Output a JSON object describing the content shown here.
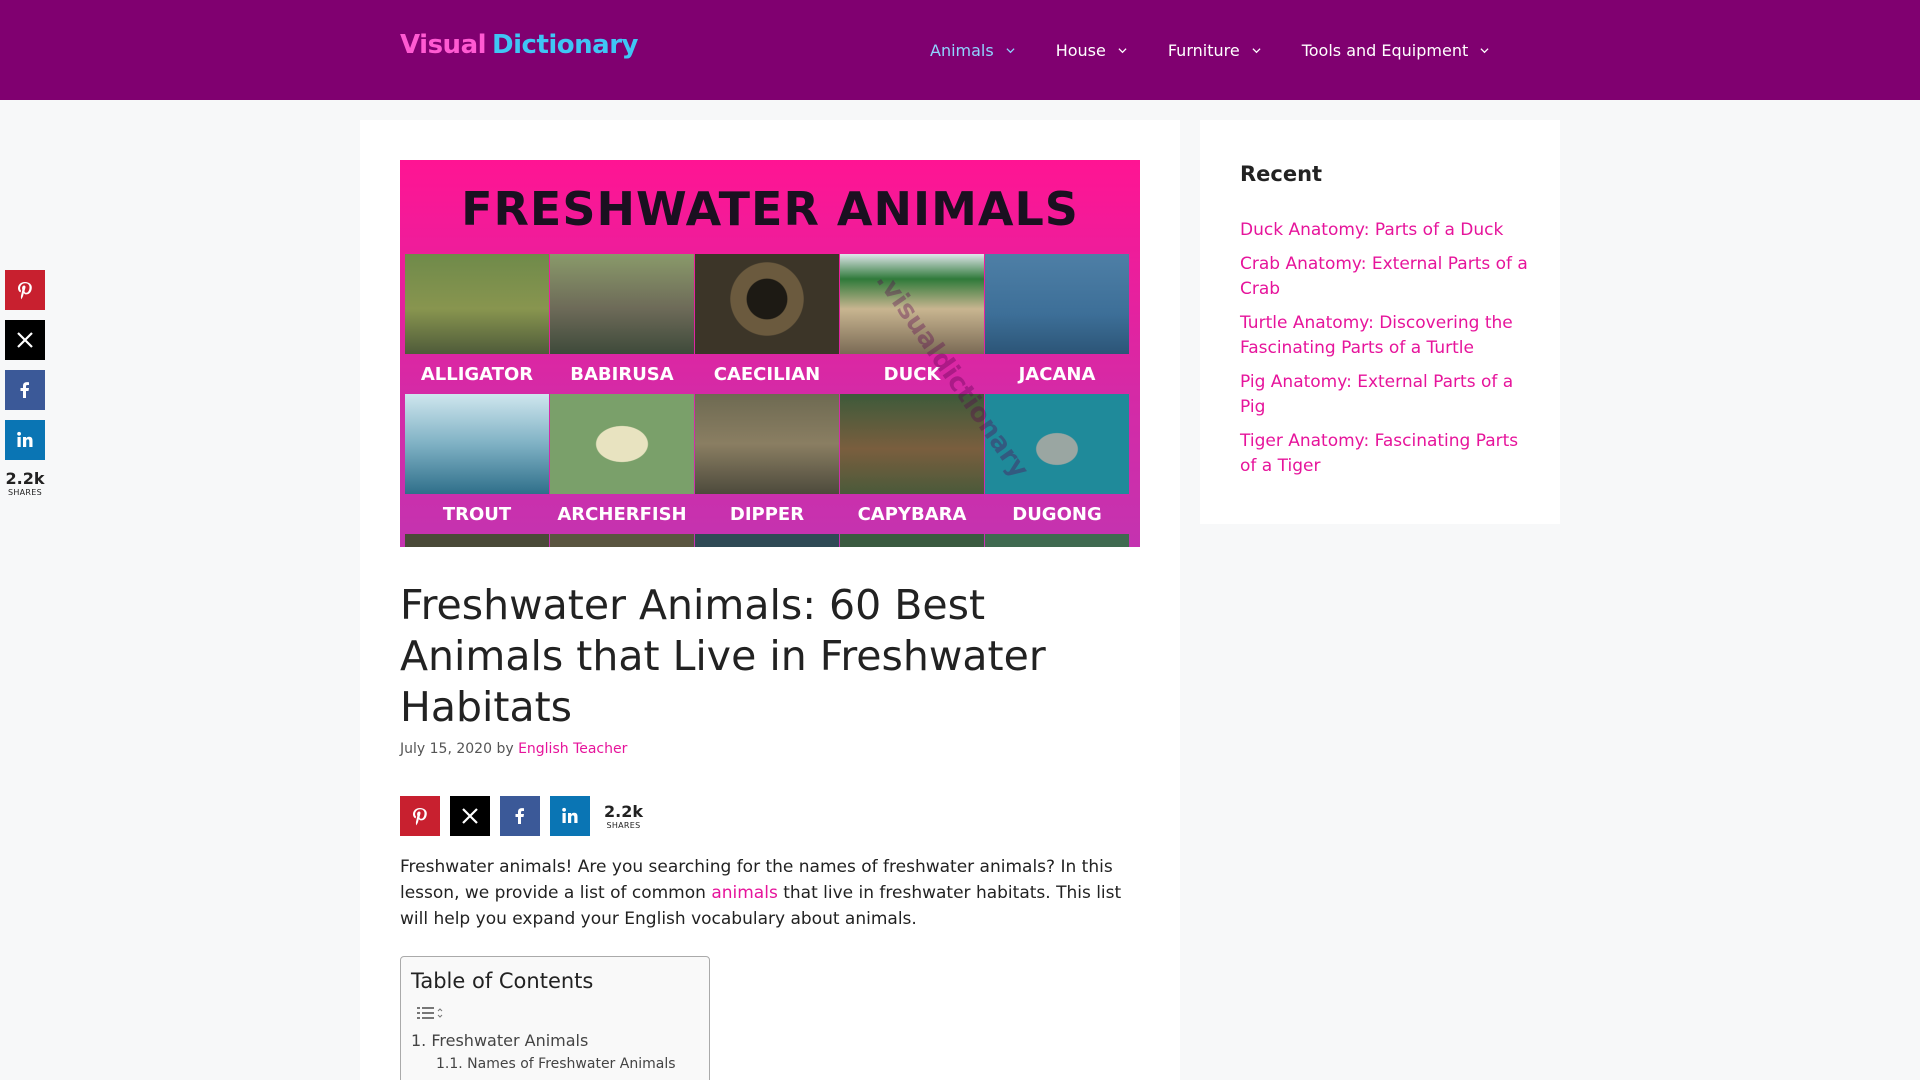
{
  "header": {
    "logo_word1": "Visual",
    "logo_word2": "Dictionary",
    "nav": [
      "Animals",
      "House",
      "Furniture",
      "Tools and Equipment"
    ]
  },
  "share": {
    "count": "2.2k",
    "label": "SHARES",
    "buttons": [
      "pinterest-icon",
      "x-icon",
      "facebook-icon",
      "linkedin-icon"
    ]
  },
  "hero": {
    "title": "FRESHWATER ANIMALS",
    "row1": [
      "ALLIGATOR",
      "BABIRUSA",
      "CAECILIAN",
      "DUCK",
      "JACANA"
    ],
    "row2": [
      "TROUT",
      "ARCHERFISH",
      "DIPPER",
      "CAPYBARA",
      "DUGONG"
    ],
    "watermark": ".visualdictionary"
  },
  "post": {
    "title": "Freshwater Animals: 60 Best Animals that Live in Freshwater Habitats",
    "date": "July 15, 2020",
    "by": "by",
    "author": "English Teacher",
    "intro_before": "Freshwater animals! Are you searching for the names of freshwater animals? In this lesson, we provide a list of common ",
    "intro_link": "animals",
    "intro_after": " that live in freshwater habitats. This list will help you expand your English vocabulary about animals."
  },
  "toc": {
    "title": "Table of Contents",
    "item1_num": "1.",
    "item1": "Freshwater Animals",
    "item2_num": "1.1.",
    "item2": "Names of Freshwater Animals"
  },
  "sidebar": {
    "heading": "Recent",
    "items": [
      "Duck Anatomy: Parts of a Duck",
      "Crab Anatomy: External Parts of a Crab",
      "Turtle Anatomy: Discovering the Fascinating Parts of a Turtle",
      "Pig Anatomy: External Parts of a Pig",
      "Tiger Anatomy: Fascinating Parts of a Tiger"
    ]
  },
  "colors": {
    "header_bg": "#800070",
    "link": "#e6149b",
    "nav_active": "#8fd4ff",
    "pinterest": "#c8202f",
    "x": "#000000",
    "facebook": "#3b5998",
    "linkedin": "#0a75b4"
  }
}
